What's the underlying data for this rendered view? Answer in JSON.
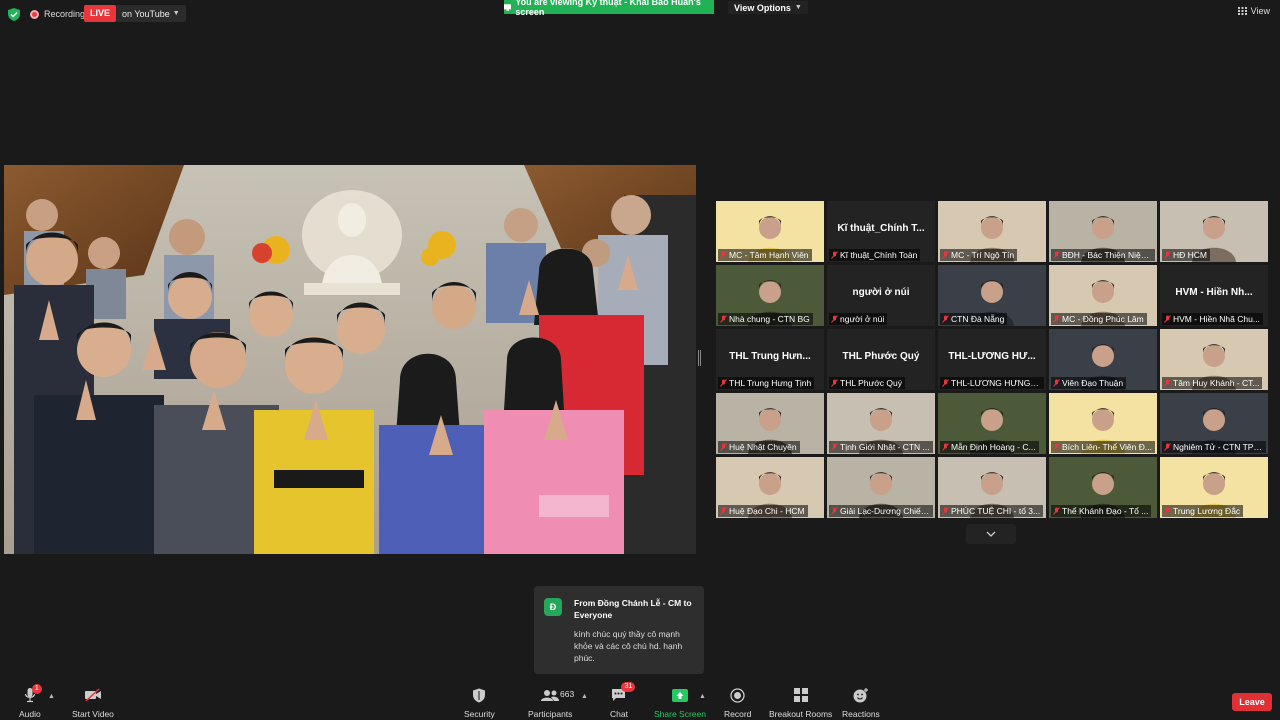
{
  "top_bar": {
    "recording_label": "Recording",
    "live_badge": "LIVE",
    "live_destination": "on YouTube",
    "viewing_banner": "You are viewing Kỹ thuật - Khải Bảo Huấn's screen",
    "view_options_label": "View Options",
    "view_label": "View"
  },
  "gallery": {
    "tiles": [
      {
        "label": "MC - Tâm Hạnh Viên",
        "video": true
      },
      {
        "label": "Kĩ thuật_Chính Toàn",
        "display_name": "Kĩ thuật_Chính T...",
        "video": false
      },
      {
        "label": "MC - Trí Ngộ Tín",
        "video": true
      },
      {
        "label": "BĐH - Bác Thiện Niệm Chí",
        "video": true,
        "active_speaker": true
      },
      {
        "label": "HĐ HCM",
        "video": true
      },
      {
        "label": "Nhà chung - CTN BG",
        "video": true
      },
      {
        "label": "người ở núi",
        "display_name": "người ở núi",
        "video": false
      },
      {
        "label": "CTN Đà Nẵng",
        "video": true
      },
      {
        "label": "MC - Đồng Phúc Lâm",
        "video": true
      },
      {
        "label": "HVM - Hiền Nhã Chu...",
        "display_name": "HVM - Hiền Nh...",
        "video": false
      },
      {
        "label": "THL Trung Hưng Tịnh",
        "display_name": "THL Trung Hưn...",
        "video": false
      },
      {
        "label": "THL Phước Quý",
        "display_name": "THL Phước Quý",
        "video": false
      },
      {
        "label": "THL-LƯƠNG HƯNG C...",
        "display_name": "THL-LƯƠNG HƯ...",
        "video": false
      },
      {
        "label": "Viên Đạo Thuận",
        "video": true
      },
      {
        "label": "Tâm Huy Khánh - CT...",
        "video": true
      },
      {
        "label": "Huệ Nhật Chuyên",
        "video": true
      },
      {
        "label": "Tịnh Giới Nhật - CTN ...",
        "video": true
      },
      {
        "label": "Mẫn Định Hoàng - C...",
        "video": true
      },
      {
        "label": "Bích Liên- Thể Viên Đ...",
        "video": true
      },
      {
        "label": "Nghiêm Tử - CTN TPH...",
        "video": true
      },
      {
        "label": "Huệ Đạo Chi - HCM",
        "video": true
      },
      {
        "label": "Giải Lạc-Dương Chiếu...",
        "video": true
      },
      {
        "label": "PHÚC TUỆ CHI - tổ 3...",
        "video": true
      },
      {
        "label": "Thể Khánh Đạo - Tổ ...",
        "video": true
      },
      {
        "label": "Trung Lương Đắc",
        "video": true
      }
    ]
  },
  "chat_popup": {
    "avatar_letter": "Đ",
    "from": "From Đồng Chánh Lễ - CM to Everyone",
    "message": "kính chúc quý thầy cô mạnh khỏe và các cô chú hd. hạnh phúc."
  },
  "toolbar": {
    "audio_label": "Audio",
    "audio_badge": "1",
    "start_video_label": "Start Video",
    "security_label": "Security",
    "participants_label": "Participants",
    "participants_count": "663",
    "chat_label": "Chat",
    "chat_badge": "31",
    "share_screen_label": "Share Screen",
    "record_label": "Record",
    "breakout_label": "Breakout Rooms",
    "reactions_label": "Reactions",
    "leave_label": "Leave"
  },
  "colors": {
    "background": "#1a1a1a",
    "live_red": "#e8363b",
    "share_green": "#20b254",
    "active_speaker": "#c8e03a",
    "leave_red": "#e02f35"
  }
}
